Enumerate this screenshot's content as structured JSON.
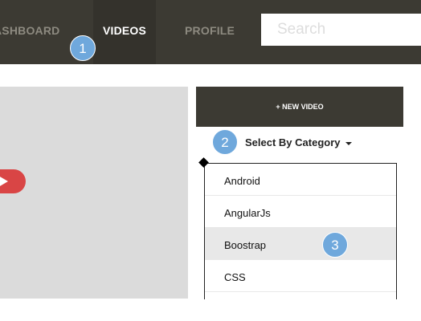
{
  "nav": {
    "items": [
      {
        "label": "ASHBOARD"
      },
      {
        "label": "VIDEOS"
      },
      {
        "label": "PROFILE"
      }
    ],
    "active": "VIDEOS",
    "search_placeholder": "Search"
  },
  "video_player": {
    "play_icon": "play-icon"
  },
  "sidebar": {
    "new_video_label": "+ NEW VIDEO",
    "category_toggle_label": "Select By Category",
    "categories": [
      {
        "label": "Android"
      },
      {
        "label": "AngularJs"
      },
      {
        "label": "Boostrap"
      },
      {
        "label": "CSS"
      }
    ],
    "highlighted_category": "Boostrap"
  },
  "markers": [
    "1",
    "2",
    "3"
  ],
  "colors": {
    "nav_bg": "#3c3a33",
    "active_tab_bg": "#34322c",
    "video_bg": "#dbdbdb",
    "play_button": "#d94545",
    "marker": "#6fa8dc"
  }
}
